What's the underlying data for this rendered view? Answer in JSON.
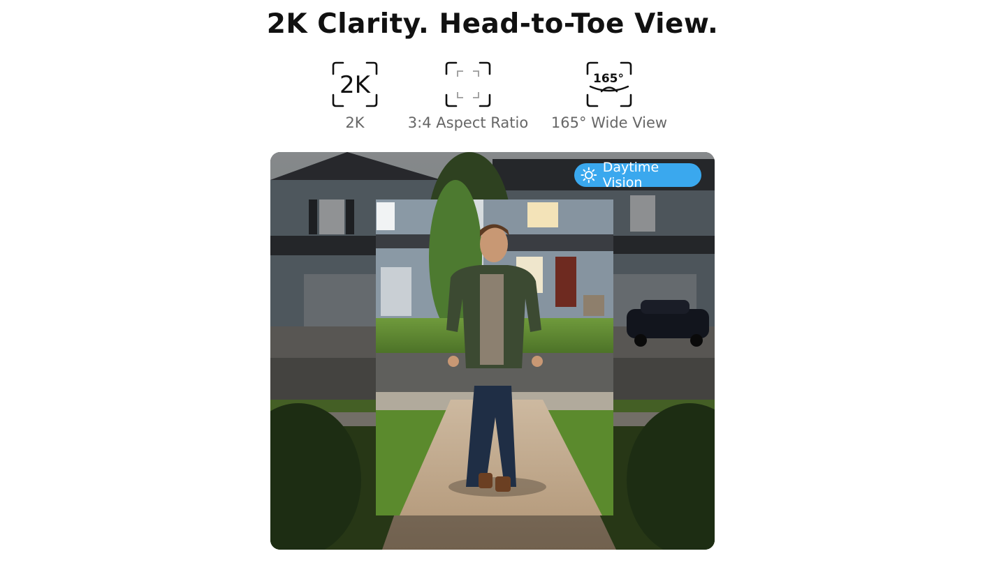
{
  "headline": "2K Clarity. Head-to-Toe View.",
  "features": [
    {
      "icon": "2k-resolution-icon",
      "icon_text": "2K",
      "label": "2K"
    },
    {
      "icon": "aspect-ratio-icon",
      "label": "3:4 Aspect Ratio"
    },
    {
      "icon": "wide-angle-icon",
      "icon_text": "165°",
      "label": "165° Wide View"
    }
  ],
  "badge": {
    "icon": "sun-icon",
    "label": "Daytime Vision"
  },
  "colors": {
    "accent": "#3aa8ee",
    "title": "#111111",
    "label": "#666666"
  }
}
